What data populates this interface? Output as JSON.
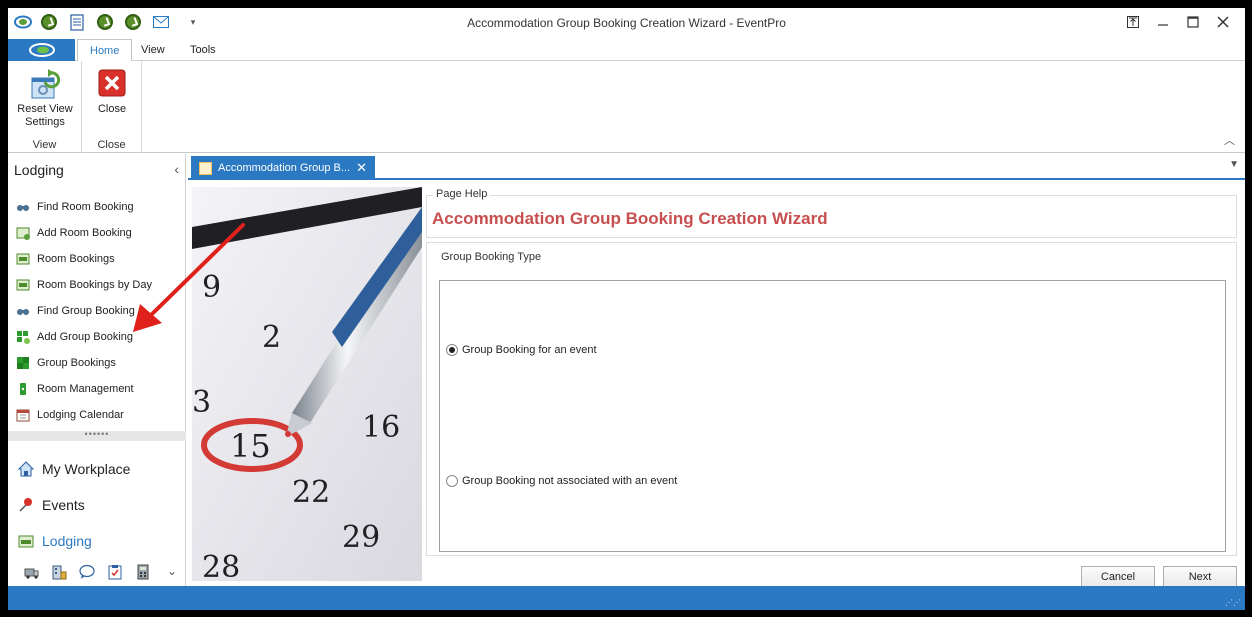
{
  "window": {
    "title": "Accommodation Group Booking Creation Wizard - EventPro"
  },
  "ribbon": {
    "tabs": [
      {
        "label": "Home",
        "active": true
      },
      {
        "label": "View",
        "active": false
      },
      {
        "label": "Tools",
        "active": false
      }
    ],
    "groups": [
      {
        "label": "View",
        "button": "Reset View Settings"
      },
      {
        "label": "Close",
        "button": "Close"
      }
    ]
  },
  "nav": {
    "header": "Lodging",
    "items": [
      {
        "label": "Find Room Booking",
        "icon": "binoculars-icon"
      },
      {
        "label": "Add Room Booking",
        "icon": "add-room-icon"
      },
      {
        "label": "Room Bookings",
        "icon": "room-bookings-icon"
      },
      {
        "label": "Room Bookings by Day",
        "icon": "room-bookings-day-icon"
      },
      {
        "label": "Find Group Booking",
        "icon": "binoculars-icon"
      },
      {
        "label": "Add Group Booking",
        "icon": "add-group-icon"
      },
      {
        "label": "Group Bookings",
        "icon": "group-bookings-icon"
      },
      {
        "label": "Room Management",
        "icon": "room-management-icon"
      },
      {
        "label": "Lodging Calendar",
        "icon": "calendar-icon"
      }
    ],
    "splitter": "••••••",
    "modules": [
      {
        "label": "My Workplace",
        "icon": "home-icon",
        "active": false
      },
      {
        "label": "Events",
        "icon": "pushpin-icon",
        "active": false
      },
      {
        "label": "Lodging",
        "icon": "lodging-icon",
        "active": true
      }
    ],
    "footer_icons": [
      "truck-icon",
      "building-icon",
      "chat-icon",
      "clipboard-icon",
      "calculator-icon",
      "chevron-down-icon"
    ]
  },
  "document": {
    "tab_label": "Accommodation Group B...",
    "close_glyph": "✕",
    "menu_glyph": "▼"
  },
  "wizard": {
    "page_help_label": "Page Help",
    "title": "Accommodation Group Booking Creation Wizard",
    "group_label": "Group Booking Type",
    "options": [
      {
        "label": "Group Booking for an event",
        "selected": true
      },
      {
        "label": "Group Booking not associated with an event",
        "selected": false
      }
    ],
    "buttons": {
      "cancel": "Cancel",
      "next": "Next"
    }
  },
  "colors": {
    "accent": "#2b79c2",
    "title_red": "#c84f4f",
    "arrow_red": "#e0201b"
  }
}
